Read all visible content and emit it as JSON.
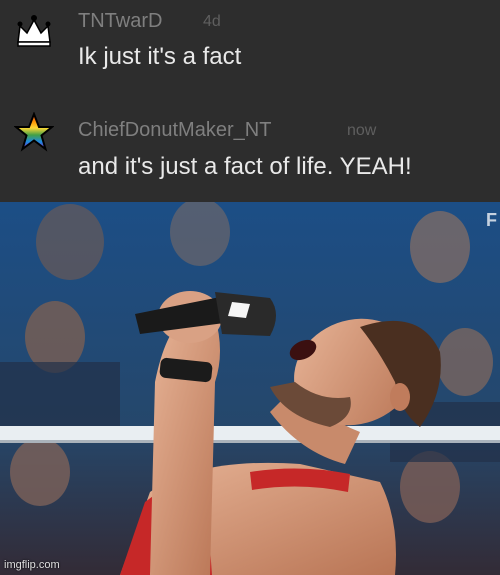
{
  "comments": [
    {
      "username": "TNTwarD",
      "timestamp": "4d",
      "text": "Ik just it's a fact",
      "badge_icon": "crown-icon"
    },
    {
      "username": "ChiefDonutMaker_NT",
      "timestamp": "now",
      "text": "and it's just a fact of life. YEAH!",
      "badge_icon": "rainbow-star-icon"
    }
  ],
  "meme_image": {
    "corner_mark": "F",
    "watermark": "imgflip.com"
  },
  "colors": {
    "background": "#2d2d2d",
    "username": "#7f7f7f",
    "timestamp": "#5f5f5f",
    "comment_text": "#e9e9e9"
  }
}
